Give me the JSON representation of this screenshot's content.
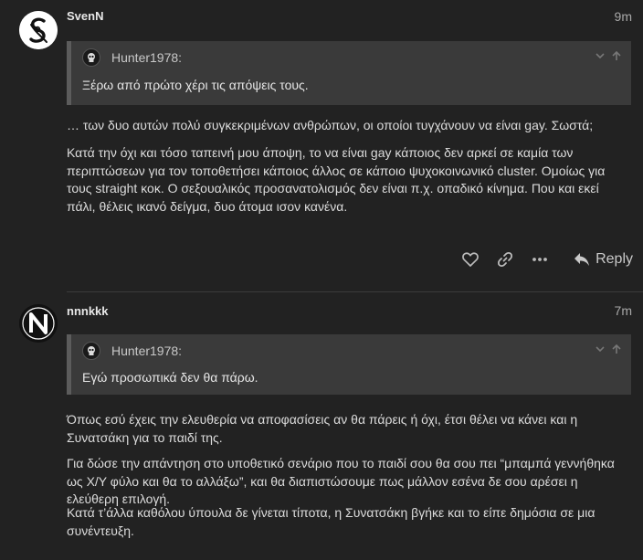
{
  "posts": [
    {
      "username": "SvenN",
      "time": "9m",
      "avatar_icon": "ampersand-s-logo-icon",
      "quote": {
        "user": "Hunter1978:",
        "text": "Ξέρω από πρώτο χέρι τις απόψεις τους."
      },
      "paragraphs": [
        "… των δυο αυτών πολύ συγκεκριμένων ανθρώπων, οι οποίοι τυγχάνουν να είναι gay. Σωστά;",
        "Κατά την όχι και τόσο ταπεινή μου άποψη, το να είναι gay κάποιος δεν αρκεί σε καμία των περιπτώσεων για τον τοποθετήσει κάποιος άλλος σε κάποιο ψυχοκοινωνικό cluster. Ομοίως για τους straight κοκ. Ο σεξουαλικός προσανατολισμός δεν είναι π.χ. οπαδικό κίνημα. Που και εκεί πάλι, θέλεις ικανό δείγμα, δυο άτομα ισον κανένα."
      ],
      "actions": {
        "like_icon": "heart-icon",
        "link_icon": "link-icon",
        "more_icon": "ellipsis-icon",
        "reply_label": "Reply"
      }
    },
    {
      "username": "nnnkkk",
      "time": "7m",
      "avatar_icon": "n-logo-icon",
      "quote": {
        "user": "Hunter1978:",
        "text": "Εγώ προσωπικά δεν θα πάρω."
      },
      "paragraphs": [
        "Όπως εσύ έχεις την ελευθερία να αποφασίσεις αν θα πάρεις ή όχι, έτσι θέλει να κάνει και η Συνατσάκη για το παιδί της.",
        "Για δώσε την απάντηση στο υποθετικό σενάριο που το παιδί σου θα σου πει “μπαμπά γεννήθηκα ως Χ/Υ φύλο και θα το αλλάξω”, και θα διαπιστώσουμε πως μάλλον εσένα δε σου αρέσει η ελεύθερη επιλογή.",
        "Κατά τ’άλλα καθόλου ύπουλα δε γίνεται τίποτα, η Συνατσάκη βγήκε και το είπε δημόσια σε μια συνέντευξη."
      ]
    }
  ]
}
